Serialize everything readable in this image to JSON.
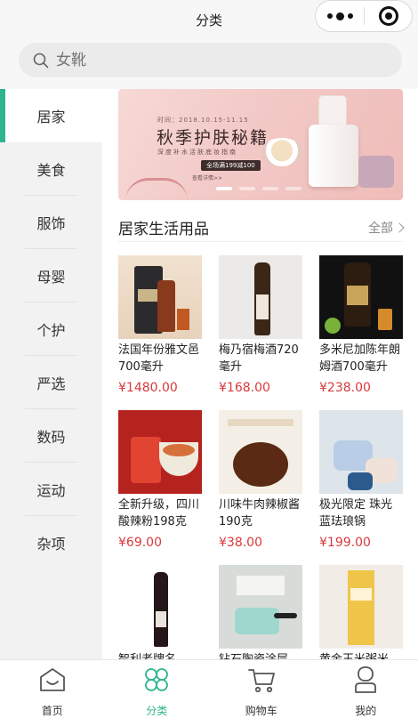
{
  "header": {
    "title": "分类"
  },
  "search": {
    "placeholder": "女靴"
  },
  "sidebar": {
    "items": [
      {
        "label": "居家",
        "active": true
      },
      {
        "label": "美食",
        "active": false
      },
      {
        "label": "服饰",
        "active": false
      },
      {
        "label": "母婴",
        "active": false
      },
      {
        "label": "个护",
        "active": false
      },
      {
        "label": "严选",
        "active": false
      },
      {
        "label": "数码",
        "active": false
      },
      {
        "label": "运动",
        "active": false
      },
      {
        "label": "杂项",
        "active": false
      }
    ]
  },
  "banner": {
    "date_text": "时间：2018.10.15-11.15",
    "title": "秋季护肤秘籍",
    "subtitle": "深度补水活肤底妆指南",
    "pill": "全场满199减100",
    "more": "查看详情>>",
    "slide_count": 4,
    "active_slide": 1
  },
  "section": {
    "title": "居家生活用品",
    "more_label": "全部"
  },
  "products": [
    {
      "name": "法国年份雅文邑700毫升",
      "price": "¥1480.00"
    },
    {
      "name": "梅乃宿梅酒720毫升",
      "price": "¥168.00"
    },
    {
      "name": "多米尼加陈年朗姆酒700毫升",
      "price": "¥238.00"
    },
    {
      "name": "全新升级，四川酸辣粉198克",
      "price": "¥69.00"
    },
    {
      "name": "川味牛肉辣椒酱190克",
      "price": "¥38.00"
    },
    {
      "name": "极光限定 珠光蓝珐琅锅",
      "price": "¥199.00"
    },
    {
      "name": "智利老牌名",
      "price": ""
    },
    {
      "name": "钻石陶瓷涂层",
      "price": ""
    },
    {
      "name": "黄金玉米粥米",
      "price": ""
    }
  ],
  "tabbar": {
    "items": [
      {
        "label": "首页",
        "icon": "home-icon",
        "active": false
      },
      {
        "label": "分类",
        "icon": "category-icon",
        "active": true
      },
      {
        "label": "购物车",
        "icon": "cart-icon",
        "active": false
      },
      {
        "label": "我的",
        "icon": "user-icon",
        "active": false
      }
    ]
  },
  "colors": {
    "accent": "#2fb58e",
    "price": "#d9393c"
  }
}
